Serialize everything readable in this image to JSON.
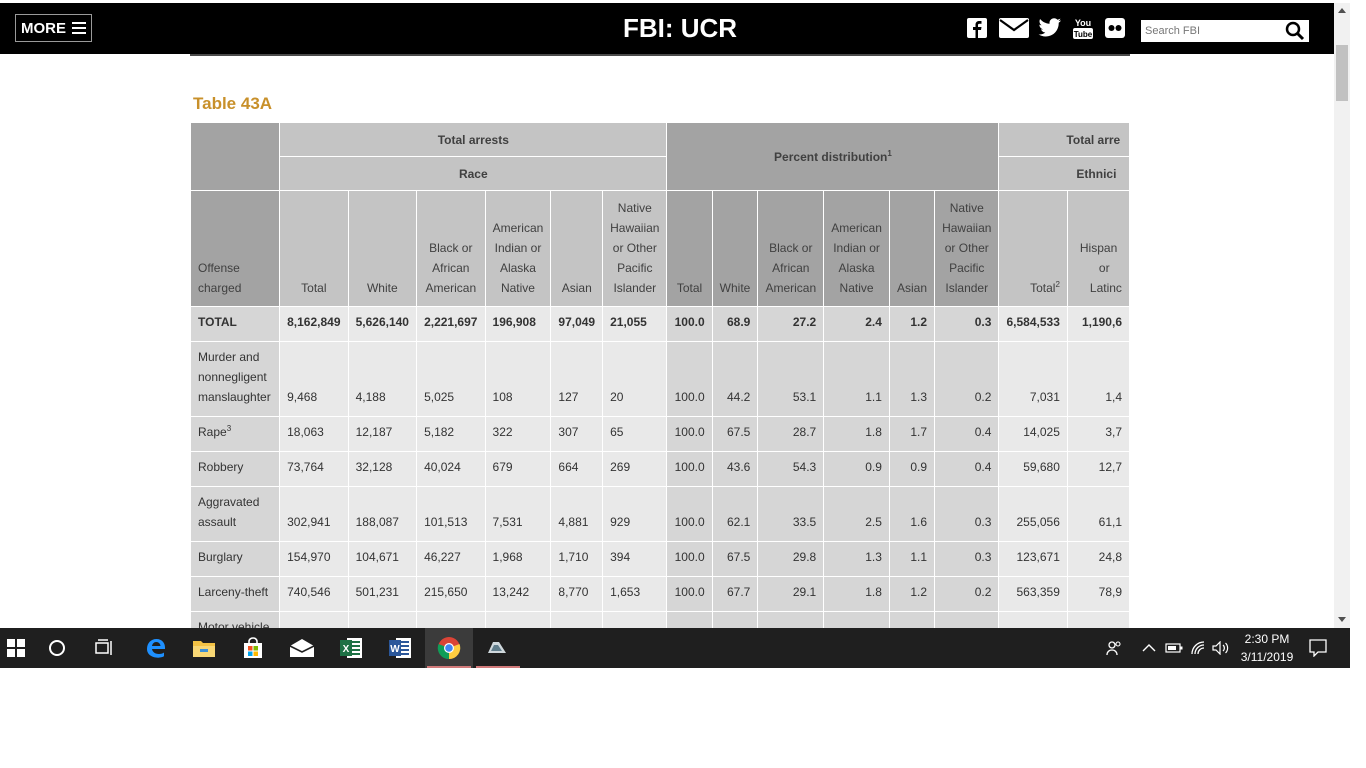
{
  "header": {
    "more_label": "MORE",
    "site_title": "FBI: UCR",
    "search_placeholder": "Search FBI",
    "social_icons": [
      "facebook-icon",
      "mail-icon",
      "twitter-icon",
      "youtube-icon",
      "flickr-icon"
    ]
  },
  "table": {
    "title": "Table 43A",
    "group1": "Total arrests",
    "group1_race": "Race",
    "group2": "Percent distribution",
    "group2_sup": "1",
    "group3": "Total arre",
    "group3_sub": "Ethnici",
    "columns": {
      "offense": [
        "Offense",
        "charged"
      ],
      "total": "Total",
      "white": "White",
      "black": [
        "Black or",
        "African",
        "American"
      ],
      "aian": [
        "American",
        "Indian or",
        "Alaska",
        "Native"
      ],
      "asian": "Asian",
      "nhopi": [
        "Native",
        "Hawaiian",
        "or Other",
        "Pacific",
        "Islander"
      ],
      "eth_total": "Total",
      "eth_total_sup": "2",
      "hispanic": [
        "Hispan",
        "or",
        "Latinc"
      ]
    },
    "rows": [
      {
        "offense": "TOTAL",
        "sup": "",
        "total": "8,162,849",
        "white": "5,626,140",
        "black": "2,221,697",
        "aian": "196,908",
        "asian": "97,049",
        "nhopi": "21,055",
        "p_total": "100.0",
        "p_white": "68.9",
        "p_black": "27.2",
        "p_aian": "2.4",
        "p_asian": "1.2",
        "p_nhopi": "0.3",
        "eth_total": "6,584,533",
        "hisp": "1,190,6"
      },
      {
        "offense": "Murder and nonnegligent manslaughter",
        "sup": "",
        "total": "9,468",
        "white": "4,188",
        "black": "5,025",
        "aian": "108",
        "asian": "127",
        "nhopi": "20",
        "p_total": "100.0",
        "p_white": "44.2",
        "p_black": "53.1",
        "p_aian": "1.1",
        "p_asian": "1.3",
        "p_nhopi": "0.2",
        "eth_total": "7,031",
        "hisp": "1,4"
      },
      {
        "offense": "Rape",
        "sup": "3",
        "total": "18,063",
        "white": "12,187",
        "black": "5,182",
        "aian": "322",
        "asian": "307",
        "nhopi": "65",
        "p_total": "100.0",
        "p_white": "67.5",
        "p_black": "28.7",
        "p_aian": "1.8",
        "p_asian": "1.7",
        "p_nhopi": "0.4",
        "eth_total": "14,025",
        "hisp": "3,7"
      },
      {
        "offense": "Robbery",
        "sup": "",
        "total": "73,764",
        "white": "32,128",
        "black": "40,024",
        "aian": "679",
        "asian": "664",
        "nhopi": "269",
        "p_total": "100.0",
        "p_white": "43.6",
        "p_black": "54.3",
        "p_aian": "0.9",
        "p_asian": "0.9",
        "p_nhopi": "0.4",
        "eth_total": "59,680",
        "hisp": "12,7"
      },
      {
        "offense": "Aggravated assault",
        "sup": "",
        "total": "302,941",
        "white": "188,087",
        "black": "101,513",
        "aian": "7,531",
        "asian": "4,881",
        "nhopi": "929",
        "p_total": "100.0",
        "p_white": "62.1",
        "p_black": "33.5",
        "p_aian": "2.5",
        "p_asian": "1.6",
        "p_nhopi": "0.3",
        "eth_total": "255,056",
        "hisp": "61,1"
      },
      {
        "offense": "Burglary",
        "sup": "",
        "total": "154,970",
        "white": "104,671",
        "black": "46,227",
        "aian": "1,968",
        "asian": "1,710",
        "nhopi": "394",
        "p_total": "100.0",
        "p_white": "67.5",
        "p_black": "29.8",
        "p_aian": "1.3",
        "p_asian": "1.1",
        "p_nhopi": "0.3",
        "eth_total": "123,671",
        "hisp": "24,8"
      },
      {
        "offense": "Larceny-theft",
        "sup": "",
        "total": "740,546",
        "white": "501,231",
        "black": "215,650",
        "aian": "13,242",
        "asian": "8,770",
        "nhopi": "1,653",
        "p_total": "100.0",
        "p_white": "67.7",
        "p_black": "29.1",
        "p_aian": "1.8",
        "p_asian": "1.2",
        "p_nhopi": "0.2",
        "eth_total": "563,359",
        "hisp": "78,9"
      },
      {
        "offense": "Motor vehicle",
        "sup": "",
        "total": "",
        "white": "",
        "black": "",
        "aian": "",
        "asian": "",
        "nhopi": "",
        "p_total": "",
        "p_white": "",
        "p_black": "",
        "p_aian": "",
        "p_asian": "",
        "p_nhopi": "",
        "eth_total": "",
        "hisp": ""
      }
    ]
  },
  "taskbar": {
    "apps": [
      "windows-start-icon",
      "cortana-search-icon",
      "task-view-icon",
      "edge-icon",
      "file-explorer-icon",
      "store-icon",
      "mail-icon",
      "excel-icon",
      "word-icon",
      "chrome-icon",
      "app-icon"
    ],
    "time": "2:30 PM",
    "date": "3/11/2019"
  }
}
